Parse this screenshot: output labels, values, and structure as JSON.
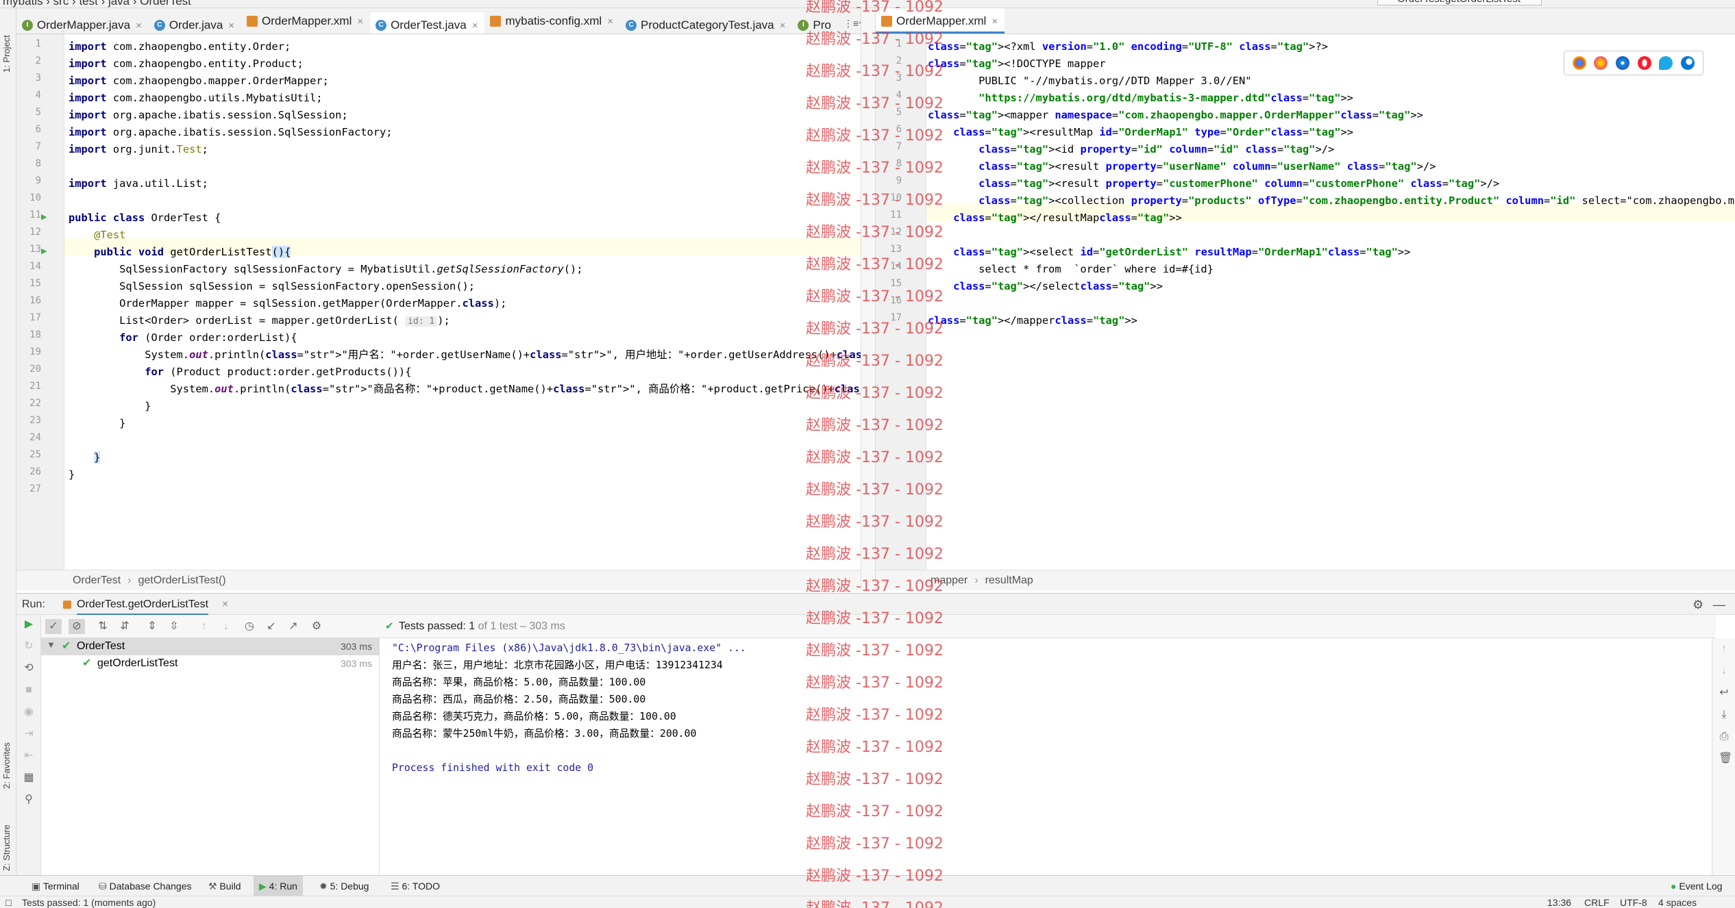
{
  "topbar": {
    "crumbs": "mybatis  ›  src  ›  test  ›  java  ›  OrderTest",
    "run_config": "OrderTest.getOrderListTest"
  },
  "left_stripe": {
    "project": "1: Project",
    "favorites": "2: Favorites",
    "structure": "Z: Structure"
  },
  "tabs_left": [
    {
      "label": "OrderMapper.java",
      "icon": "interface-icon"
    },
    {
      "label": "Order.java",
      "icon": "class-icon"
    },
    {
      "label": "OrderMapper.xml",
      "icon": "xml-icon"
    },
    {
      "label": "OrderTest.java",
      "icon": "class-icon",
      "active": true
    },
    {
      "label": "mybatis-config.xml",
      "icon": "xml-icon"
    },
    {
      "label": "ProductCategoryTest.java",
      "icon": "class-icon"
    },
    {
      "label": "Pro",
      "icon": "interface-icon"
    }
  ],
  "tabs_left_more": "⋮≡⁴",
  "tabs_right": [
    {
      "label": "OrderMapper.xml",
      "icon": "xml-icon",
      "active": true
    }
  ],
  "java_lines": [
    "import com.zhaopengbo.entity.Order;",
    "import com.zhaopengbo.entity.Product;",
    "import com.zhaopengbo.mapper.OrderMapper;",
    "import com.zhaopengbo.utils.MybatisUtil;",
    "import org.apache.ibatis.session.SqlSession;",
    "import org.apache.ibatis.session.SqlSessionFactory;",
    "import org.junit.Test;",
    "",
    "import java.util.List;",
    "",
    "public class OrderTest {",
    "    @Test",
    "    public void getOrderListTest(){",
    "        SqlSessionFactory sqlSessionFactory = MybatisUtil.getSqlSessionFactory();",
    "        SqlSession sqlSession = sqlSessionFactory.openSession();",
    "        OrderMapper mapper = sqlSession.getMapper(OrderMapper.class);",
    "        List<Order> orderList = mapper.getOrderList( id: 1);",
    "        for (Order order:orderList){",
    "            System.out.println(\"用户名：\"+order.getUserName()+\", 用户地址：\"+order.getUserAddress()+\", 用户电话：\"+order.getCustomerPho",
    "            for (Product product:order.getProducts()){",
    "                System.out.println(\"商品名称：\"+product.getName()+\", 商品价格：\"+product.getPrice()+\", 商品数量：\"+product.getStock());",
    "            }",
    "        }",
    "",
    "    }",
    "}",
    ""
  ],
  "xml_lines": [
    "<?xml version=\"1.0\" encoding=\"UTF-8\" ?>",
    "<!DOCTYPE mapper",
    "        PUBLIC \"-//mybatis.org//DTD Mapper 3.0//EN\"",
    "        \"https://mybatis.org/dtd/mybatis-3-mapper.dtd\">",
    "<mapper namespace=\"com.zhaopengbo.mapper.OrderMapper\">",
    "    <resultMap id=\"OrderMap1\" type=\"Order\">",
    "        <id property=\"id\" column=\"id\" />",
    "        <result property=\"userName\" column=\"userName\" />",
    "        <result property=\"customerPhone\" column=\"customerPhone\" />",
    "        <collection property=\"products\" ofType=\"com.zhaopengbo.entity.Product\" column=\"id\" select=\"com.zhaopengbo.mapper.ProductMap",
    "    </resultMap>",
    "",
    "    <select id=\"getOrderList\" resultMap=\"OrderMap1\">",
    "        select * from  `order` where id=#{id}",
    "    </select>",
    "",
    "</mapper>"
  ],
  "breadcrumb_left": {
    "class": "OrderTest",
    "method": "getOrderListTest()"
  },
  "breadcrumb_right": {
    "root": "mapper",
    "node": "resultMap"
  },
  "run": {
    "label": "Run:",
    "config_tab": "OrderTest.getOrderListTest",
    "tests_passed": "Tests passed:",
    "passed_count": "1",
    "passed_suffix": "of 1 test – 303 ms",
    "tree": [
      {
        "name": "OrderTest",
        "time": "303 ms"
      },
      {
        "name": "getOrderListTest",
        "time": "303 ms"
      }
    ],
    "console": [
      "\"C:\\Program Files (x86)\\Java\\jdk1.8.0_73\\bin\\java.exe\" ...",
      "用户名：张三，用户地址：北京市花园路小区，用户电话：13912341234",
      "商品名称：苹果，商品价格：5.00，商品数量：100.00",
      "商品名称：西瓜，商品价格：2.50，商品数量：500.00",
      "商品名称：德芙巧克力，商品价格：5.00，商品数量：100.00",
      "商品名称：蒙牛250ml牛奶，商品价格：3.00，商品数量：200.00",
      "",
      "Process finished with exit code 0"
    ]
  },
  "toolwindows": [
    {
      "label": "Terminal",
      "icon": "terminal-icon"
    },
    {
      "label": "Database Changes",
      "icon": "database-icon"
    },
    {
      "label": "Build",
      "icon": "hammer-icon"
    },
    {
      "label": "4: Run",
      "icon": "run-icon",
      "active": true
    },
    {
      "label": "5: Debug",
      "icon": "bug-icon"
    },
    {
      "label": "6: TODO",
      "icon": "todo-icon"
    }
  ],
  "event_log": "Event Log",
  "status": {
    "message": "Tests passed: 1 (moments ago)",
    "position": "13:36",
    "line_sep": "CRLF",
    "encoding": "UTF-8",
    "indent": "4 spaces"
  },
  "watermark": "赵鹏波 -137 - 1092",
  "colors": {
    "accent": "#4083c9",
    "keyword": "#000080",
    "string": "#008000",
    "watermark": "#e0393e",
    "pass": "#4caf50"
  }
}
